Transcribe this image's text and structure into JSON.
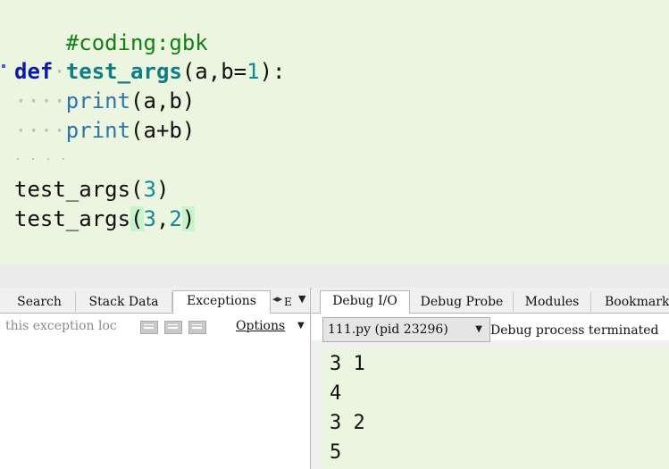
{
  "editor": {
    "comment": "#coding:gbk",
    "line_def": {
      "keyword": "def",
      "name": "test_args",
      "args_pre": "(a,b=",
      "default": "1",
      "args_post": "):"
    },
    "line_print1": {
      "builtin": "print",
      "args": "(a,b)"
    },
    "line_print2": {
      "builtin": "print",
      "args": "(a+b)"
    },
    "line_call1": {
      "name": "test_args",
      "open": "(",
      "num": "3",
      "close": ")"
    },
    "line_call2": {
      "name": "test_args",
      "open": "(",
      "num1": "3",
      "comma": ",",
      "num2": "2",
      "close": ")"
    }
  },
  "left_panel": {
    "tabs": [
      "Search",
      "Stack Data",
      "Exceptions"
    ],
    "active_tab": "Exceptions",
    "overflow_tab": "E",
    "filter_placeholder": "this exception loc",
    "options_label": "Options"
  },
  "right_panel": {
    "tabs": [
      "Debug I/O",
      "Debug Probe",
      "Modules",
      "Bookmarks"
    ],
    "active_tab": "Debug I/O",
    "process_select": "111.py (pid 23296)",
    "status": "Debug process terminated",
    "output": [
      "3 1",
      "4",
      "3 2",
      "5"
    ]
  },
  "icons": {
    "tab_scroll": "scroll-arrows-icon",
    "dropdown": "chevron-down-icon",
    "filter_buttons": "filter-toggle-icon"
  },
  "colors": {
    "editor_bg": "#ebf5df",
    "keyword": "#0b1aa8",
    "function": "#0e7d84",
    "number": "#0e8b93",
    "comment": "#138013"
  }
}
